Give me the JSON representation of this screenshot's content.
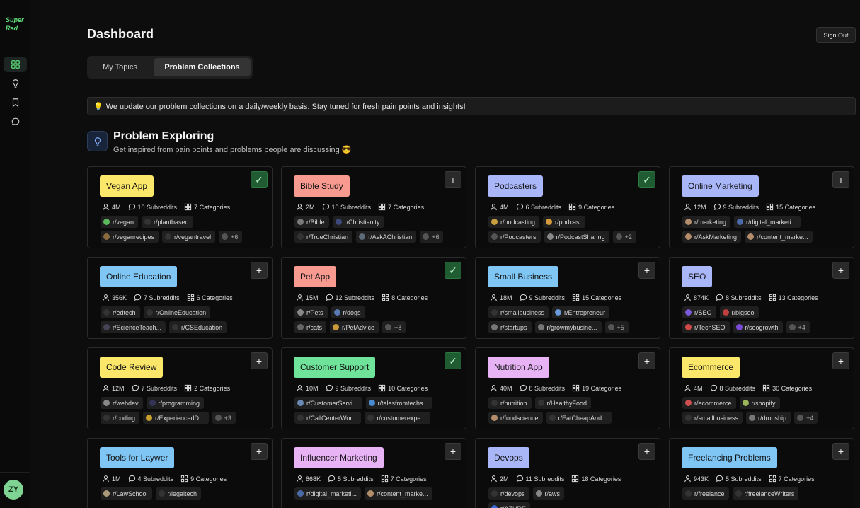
{
  "app": {
    "logo": "Super Red",
    "user_initials": "ZY"
  },
  "header": {
    "title": "Dashboard",
    "sign_out": "Sign Out"
  },
  "tabs": [
    {
      "label": "My Topics"
    },
    {
      "label": "Problem Collections"
    }
  ],
  "notice": "We update our problem collections on a daily/weekly basis. Stay tuned for fresh pain points and insights!",
  "section": {
    "title": "Problem Exploring",
    "subtitle": "Get inspired from pain points and problems people are discussing 😎"
  },
  "colors": {
    "accent": "#5fe07a",
    "checked": "#1f5c31"
  },
  "cards": [
    {
      "title": "Vegan App",
      "color": "#fbe86a",
      "state": "checked",
      "members": "4M",
      "subreddits": "10 Subreddits",
      "categories": "7 Categories",
      "chips": [
        [
          "r/vegan",
          "#5cb85c"
        ],
        [
          "r/plantbased",
          "#333"
        ],
        [
          "r/veganrecipes",
          "#8b6b3d"
        ],
        [
          "r/vegantravel",
          "#333"
        ],
        [
          "+6",
          "#555"
        ]
      ]
    },
    {
      "title": "Bible Study",
      "color": "#f99a91",
      "state": "add",
      "members": "2M",
      "subreddits": "10 Subreddits",
      "categories": "7 Categories",
      "chips": [
        [
          "r/Bible",
          "#7a7a7a"
        ],
        [
          "r/Christianity",
          "#3b4a7a"
        ],
        [
          "r/TrueChristian",
          "#333"
        ],
        [
          "r/AskAChristian",
          "#5c6a7a"
        ],
        [
          "+6",
          "#555"
        ]
      ]
    },
    {
      "title": "Podcasters",
      "color": "#a9b6f8",
      "state": "checked",
      "members": "4M",
      "subreddits": "6 Subreddits",
      "categories": "9 Categories",
      "chips": [
        [
          "r/podcasting",
          "#c8a040"
        ],
        [
          "r/podcast",
          "#d59a3a"
        ],
        [
          "r/Podcasters",
          "#555"
        ],
        [
          "r/PodcastSharing",
          "#888"
        ],
        [
          "+2",
          "#555"
        ]
      ]
    },
    {
      "title": "Online Marketing",
      "color": "#a9b6f8",
      "state": "add",
      "members": "12M",
      "subreddits": "9 Subreddits",
      "categories": "15 Categories",
      "chips": [
        [
          "r/marketing",
          "#b48d6a"
        ],
        [
          "r/digital_marketi...",
          "#4a6aa8"
        ],
        [
          "r/AskMarketing",
          "#b48d6a"
        ],
        [
          "r/content_marke...",
          "#b48d6a"
        ]
      ]
    },
    {
      "title": "Online Education",
      "color": "#7fc6f5",
      "state": "add",
      "members": "356K",
      "subreddits": "7 Subreddits",
      "categories": "6 Categories",
      "chips": [
        [
          "r/edtech",
          "#333"
        ],
        [
          "r/OnlineEducation",
          "#333"
        ],
        [
          "r/ScienceTeach...",
          "#445"
        ],
        [
          "r/CSEducation",
          "#333"
        ]
      ]
    },
    {
      "title": "Pet App",
      "color": "#f99a91",
      "state": "checked",
      "members": "15M",
      "subreddits": "12 Subreddits",
      "categories": "8 Categories",
      "chips": [
        [
          "r/Pets",
          "#888"
        ],
        [
          "r/dogs",
          "#5a7ab5"
        ],
        [
          "r/cats",
          "#666"
        ],
        [
          "r/PetAdvice",
          "#c89a3a"
        ],
        [
          "+8",
          "#555"
        ]
      ]
    },
    {
      "title": "Small Business",
      "color": "#7fc6f5",
      "state": "add",
      "members": "18M",
      "subreddits": "9 Subreddits",
      "categories": "15 Categories",
      "chips": [
        [
          "r/smallbusiness",
          "#333"
        ],
        [
          "r/Entrepreneur",
          "#6a9ad8"
        ],
        [
          "r/startups",
          "#777"
        ],
        [
          "r/growmybusine...",
          "#777"
        ],
        [
          "+5",
          "#555"
        ]
      ]
    },
    {
      "title": "SEO",
      "color": "#a9b6f8",
      "state": "add",
      "members": "874K",
      "subreddits": "8 Subreddits",
      "categories": "13 Categories",
      "chips": [
        [
          "r/SEO",
          "#7a5ad8"
        ],
        [
          "r/bigseo",
          "#c04040"
        ],
        [
          "r/TechSEO",
          "#d04848"
        ],
        [
          "r/seogrowth",
          "#7a4ad8"
        ],
        [
          "+4",
          "#555"
        ]
      ]
    },
    {
      "title": "Code Review",
      "color": "#fbe86a",
      "state": "add",
      "members": "12M",
      "subreddits": "7 Subreddits",
      "categories": "2 Categories",
      "chips": [
        [
          "r/webdev",
          "#888"
        ],
        [
          "r/programming",
          "#335"
        ],
        [
          "r/coding",
          "#333"
        ],
        [
          "r/ExperiencedD...",
          "#c8a030"
        ],
        [
          "+3",
          "#555"
        ]
      ]
    },
    {
      "title": "Customer Support",
      "color": "#6fe39a",
      "state": "checked",
      "members": "10M",
      "subreddits": "9 Subreddits",
      "categories": "10 Categories",
      "chips": [
        [
          "r/CustomerServi...",
          "#6a8ab5"
        ],
        [
          "r/talesfromtechs...",
          "#4a8ad0"
        ],
        [
          "r/CallCenterWor...",
          "#333"
        ],
        [
          "r/customerexpe...",
          "#333"
        ]
      ]
    },
    {
      "title": "Nutrition App",
      "color": "#e8b3f5",
      "state": "add",
      "members": "40M",
      "subreddits": "8 Subreddits",
      "categories": "19 Categories",
      "chips": [
        [
          "r/nutrition",
          "#333"
        ],
        [
          "r/HealthyFood",
          "#333"
        ],
        [
          "r/foodscience",
          "#b48d6a"
        ],
        [
          "r/EatCheapAnd...",
          "#333"
        ]
      ]
    },
    {
      "title": "Ecommerce",
      "color": "#fbe86a",
      "state": "add",
      "members": "4M",
      "subreddits": "8 Subreddits",
      "categories": "30 Categories",
      "chips": [
        [
          "r/ecommerce",
          "#d05050"
        ],
        [
          "r/shopify",
          "#9ab55a"
        ],
        [
          "r/smallbusiness",
          "#333"
        ],
        [
          "r/dropship",
          "#777"
        ],
        [
          "+4",
          "#555"
        ]
      ]
    },
    {
      "title": "Tools for Laywer",
      "color": "#7fc6f5",
      "state": "add",
      "members": "1M",
      "subreddits": "4 Subreddits",
      "categories": "9 Categories",
      "chips": [
        [
          "r/LawSchool",
          "#aa9a7a"
        ],
        [
          "r/legaltech",
          "#333"
        ]
      ]
    },
    {
      "title": "Influencer Marketing",
      "color": "#e8b3f5",
      "state": "add",
      "members": "868K",
      "subreddits": "5 Subreddits",
      "categories": "7 Categories",
      "chips": [
        [
          "r/digital_marketi...",
          "#4a6aa8"
        ],
        [
          "r/content_marke...",
          "#b48d6a"
        ]
      ]
    },
    {
      "title": "Devops",
      "color": "#a9b6f8",
      "state": "add",
      "members": "2M",
      "subreddits": "11 Subreddits",
      "categories": "18 Categories",
      "chips": [
        [
          "r/devops",
          "#333"
        ],
        [
          "r/aws",
          "#888"
        ],
        [
          "r/AZURE",
          "#3a6ad8"
        ]
      ]
    },
    {
      "title": "Freelancing Problems",
      "color": "#7fc6f5",
      "state": "add",
      "members": "943K",
      "subreddits": "5 Subreddits",
      "categories": "7 Categories",
      "chips": [
        [
          "r/freelance",
          "#333"
        ],
        [
          "r/freelanceWriters",
          "#333"
        ]
      ]
    }
  ]
}
